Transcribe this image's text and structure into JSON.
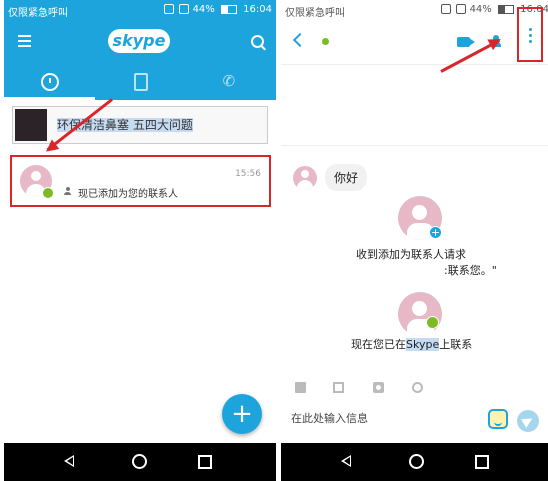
{
  "left_phone": {
    "status": {
      "carrier": "仅限紧急呼叫",
      "battery": "44%",
      "time": "16:04"
    },
    "appbar": {
      "logo": "skype"
    },
    "promo": {
      "text": "环保清洁鼻塞 五四大问题"
    },
    "chat": {
      "time": "15:56",
      "preview": "现已添加为您的联系人"
    },
    "fab_label": "+"
  },
  "right_phone": {
    "status": {
      "carrier": "仅限紧急呼叫",
      "battery": "44%",
      "time": "16:04"
    },
    "messages": {
      "hello": "你好",
      "request_line1": "收到添加为联系人请求",
      "request_line2": ":联系您。\"",
      "connected_prefix": "现在您已在",
      "connected_highlight": "Skype",
      "connected_suffix": "上联系"
    },
    "composer": {
      "placeholder": "在此处输入信息"
    }
  },
  "colors": {
    "skype_blue": "#1ea4dc",
    "highlight_red": "#d8262b",
    "presence_green": "#7dbb24",
    "avatar_pink": "#e7b9c7"
  }
}
